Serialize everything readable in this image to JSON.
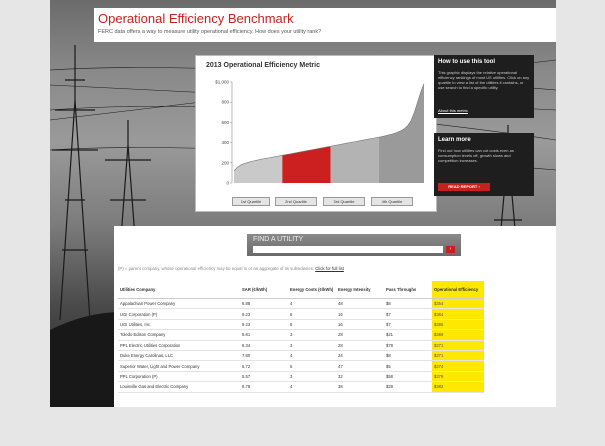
{
  "header": {
    "title": "Operational Efficiency Benchmark",
    "subtitle": "FERC data offers a way to measure utility operational efficiency. How does your utility rank?"
  },
  "chart_data": {
    "type": "area",
    "title": "2013 Operational Efficiency Metric",
    "ylabel": "",
    "xlabel": "",
    "ylim": [
      0,
      1000
    ],
    "y_ticks": [
      "$1,000",
      "800",
      "600",
      "400",
      "200",
      "0"
    ],
    "y_tick_values": [
      1000,
      800,
      600,
      400,
      200,
      0
    ],
    "quartiles": [
      {
        "name": "1st Quartile",
        "color": "#c9c9c9"
      },
      {
        "name": "2nd Quartile",
        "color": "#cc1f1f"
      },
      {
        "name": "3rd Quartile",
        "color": "#b3b3b3"
      },
      {
        "name": "4th Quartile",
        "color": "#9a9a9a"
      }
    ],
    "values": [
      120,
      155,
      175,
      190,
      200,
      210,
      218,
      225,
      232,
      238,
      244,
      250,
      256,
      262,
      268,
      274,
      280,
      286,
      292,
      298,
      304,
      310,
      316,
      322,
      328,
      334,
      340,
      346,
      352,
      358,
      364,
      370,
      376,
      382,
      388,
      394,
      400,
      406,
      412,
      418,
      424,
      430,
      436,
      442,
      448,
      454,
      460,
      468,
      476,
      484,
      494,
      506,
      520,
      540,
      570,
      620,
      700,
      800,
      900,
      985
    ]
  },
  "howto": {
    "title": "How to use this tool",
    "text": "This graphic displays the relative operational efficiency rankings of most US utilities. Click on any quartile to view a list of the utilities it contains, or use search to find a specific utility.",
    "link": "About this metric"
  },
  "learn": {
    "title": "Learn more",
    "text": "Find out how utilities can cut costs even as consumption levels off, growth slows and competition increases.",
    "button": "READ REPORT ›"
  },
  "search": {
    "label": "FIND A UTILITY",
    "placeholder": "",
    "button": "›"
  },
  "note": {
    "text": "(P) = parent company, whose operational efficiency may be equal to or an aggregate of its subsidiaries.",
    "link": "Click for full list"
  },
  "table": {
    "headers": [
      "Utilities Company",
      "SAR (¢/kWh)",
      "Energy Costs (¢/kWh)",
      "Energy Intensity",
      "Pass Throughs",
      "Operational Efficiency"
    ],
    "rows": [
      [
        "Appalachian Power Company",
        "6.88",
        "4",
        "48",
        "$8",
        "$354"
      ],
      [
        "UGI Corporation (P)",
        "9.23",
        "6",
        "16",
        "$7",
        "$364"
      ],
      [
        "UGI Utilities, Inc.",
        "9.23",
        "6",
        "16",
        "$7",
        "$365"
      ],
      [
        "Toledo Edison Company",
        "5.81",
        "3",
        "28",
        "$21",
        "$369"
      ],
      [
        "PPL Electric Utilities Corporation",
        "6.34",
        "3",
        "28",
        "$78",
        "$371"
      ],
      [
        "Duke Energy Carolinas, LLC",
        "7.80",
        "4",
        "34",
        "$8",
        "$371"
      ],
      [
        "Superior Water, Light and Power Company",
        "6.72",
        "5",
        "47",
        "$5",
        "$374"
      ],
      [
        "PPL Corporation (P)",
        "5.57",
        "3",
        "32",
        "$58",
        "$379"
      ],
      [
        "Louisville Gas and Electric Company",
        "6.78",
        "4",
        "38",
        "$28",
        "$382"
      ]
    ]
  }
}
